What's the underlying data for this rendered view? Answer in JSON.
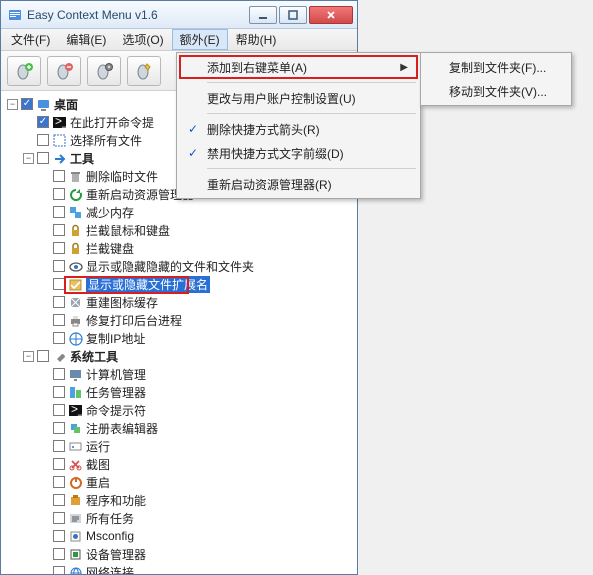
{
  "window": {
    "title": "Easy Context Menu v1.6"
  },
  "menubar": {
    "file": "文件(F)",
    "edit": "编辑(E)",
    "options": "选项(O)",
    "extra": "额外(E)",
    "help": "帮助(H)"
  },
  "dropdown": {
    "add_to_context": "添加到右键菜单(A)",
    "change_uac": "更改与用户账户控制设置(U)",
    "remove_arrow": "删除快捷方式箭头(R)",
    "disable_prefix": "禁用快捷方式文字前缀(D)",
    "restart_explorer": "重新启动资源管理器(R)"
  },
  "submenu": {
    "copy_to": "复制到文件夹(F)...",
    "move_to": "移动到文件夹(V)..."
  },
  "tree": {
    "desktop": "桌面",
    "open_cmd": "在此打开命令提",
    "select_all": "选择所有文件",
    "tools": "工具",
    "items_tools": [
      "删除临时文件",
      "重新启动资源管理器",
      "减少内存",
      "拦截鼠标和键盘",
      "拦截键盘",
      "显示或隐藏隐藏的文件和文件夹",
      "显示或隐藏文件扩展名",
      "重建图标缓存",
      "修复打印后台进程",
      "复制IP地址"
    ],
    "selected_index": 6,
    "systools": "系统工具",
    "items_sys": [
      "计算机管理",
      "任务管理器",
      "命令提示符",
      "注册表编辑器",
      "运行",
      "截图",
      "重启",
      "程序和功能",
      "所有任务",
      "Msconfig",
      "设备管理器",
      "网络连接"
    ]
  }
}
